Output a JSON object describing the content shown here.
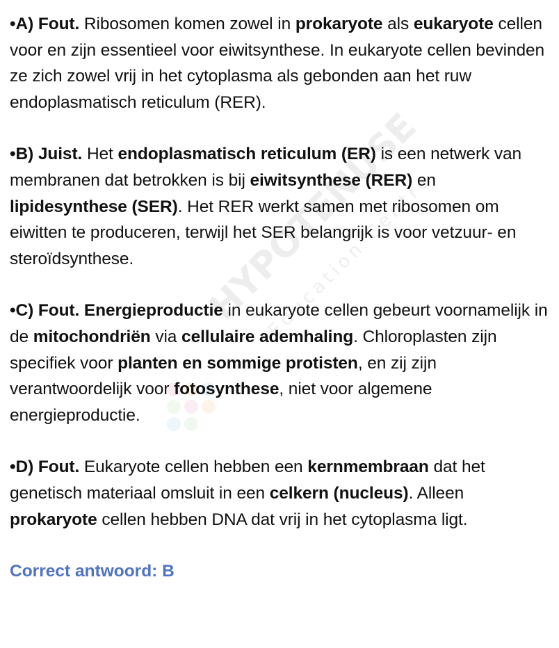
{
  "watermark": {
    "brand": "HYPOTENUSE",
    "sub": "Education Centre"
  },
  "options": [
    {
      "lead": "•A) Fout.",
      "segments": [
        {
          "t": " Ribosomen komen zowel in ",
          "b": false
        },
        {
          "t": "prokaryote",
          "b": true
        },
        {
          "t": " als ",
          "b": false
        },
        {
          "t": "eukaryote",
          "b": true
        },
        {
          "t": " cellen voor en zijn essentieel voor eiwitsynthese. In eukaryote cellen bevinden ze zich zowel vrij in het cytoplasma als gebonden aan het ruw endoplasmatisch reticulum (RER).",
          "b": false
        }
      ]
    },
    {
      "lead": "•B) Juist.",
      "segments": [
        {
          "t": " Het ",
          "b": false
        },
        {
          "t": "endoplasmatisch reticulum (ER)",
          "b": true
        },
        {
          "t": " is een netwerk van membranen dat betrokken is bij ",
          "b": false
        },
        {
          "t": "eiwitsynthese (RER)",
          "b": true
        },
        {
          "t": " en ",
          "b": false
        },
        {
          "t": "lipidesynthese (SER)",
          "b": true
        },
        {
          "t": ". Het RER werkt samen met ribosomen om eiwitten te produceren, terwijl het SER belangrijk is voor vetzuur- en steroïdsynthese.",
          "b": false
        }
      ]
    },
    {
      "lead": "•C) Fout.",
      "segments": [
        {
          "t": " ",
          "b": false
        },
        {
          "t": "Energieproductie",
          "b": true
        },
        {
          "t": " in eukaryote cellen gebeurt voornamelijk in de ",
          "b": false
        },
        {
          "t": "mitochondriën",
          "b": true
        },
        {
          "t": " via ",
          "b": false
        },
        {
          "t": "cellulaire ademhaling",
          "b": true
        },
        {
          "t": ". Chloroplasten zijn specifiek voor ",
          "b": false
        },
        {
          "t": "planten en sommige protisten",
          "b": true
        },
        {
          "t": ", en zij zijn verantwoordelijk voor ",
          "b": false
        },
        {
          "t": "fotosynthese",
          "b": true
        },
        {
          "t": ", niet voor algemene energieproductie.",
          "b": false
        }
      ]
    },
    {
      "lead": "•D) Fout.",
      "segments": [
        {
          "t": " Eukaryote cellen hebben een ",
          "b": false
        },
        {
          "t": "kernmembraan",
          "b": true
        },
        {
          "t": " dat het genetisch materiaal omsluit in een ",
          "b": false
        },
        {
          "t": "celkern (nucleus)",
          "b": true
        },
        {
          "t": ". Alleen ",
          "b": false
        },
        {
          "t": "prokaryote",
          "b": true
        },
        {
          "t": " cellen hebben DNA dat vrij in het cytoplasma ligt.",
          "b": false
        }
      ]
    }
  ],
  "answer": "Correct antwoord: B",
  "colors": {
    "text": "#111111",
    "answer": "#4f73c4"
  }
}
